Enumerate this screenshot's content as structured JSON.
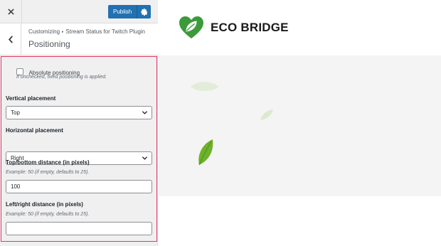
{
  "topbar": {
    "close_icon": "close-icon",
    "publish_label": "Publish",
    "settings_icon": "gear-icon"
  },
  "section": {
    "back_icon": "chevron-left-icon",
    "breadcrumb_root": "Customizing",
    "breadcrumb_separator": "▸",
    "breadcrumb_item": "Stream Status for Twitch Plugin",
    "title": "Positioning"
  },
  "controls": {
    "absolute": {
      "label": "Absolute positioning",
      "checked": false,
      "hint": "If unchecked, fixed positioning is applied."
    },
    "vertical": {
      "label": "Vertical placement",
      "value": "Top"
    },
    "horizontal": {
      "label": "Horizontal placement",
      "value": "Right"
    },
    "top_bottom": {
      "label": "Top/bottom distance (in pixels)",
      "hint": "Example: 50 (if empty, defaults to 25).",
      "value": "100"
    },
    "left_right": {
      "label": "Left/right distance (in pixels)",
      "hint": "Example: 50 (if empty, defaults to 25).",
      "value": ""
    }
  },
  "preview": {
    "brand_name": "ECO BRIDGE",
    "logo_icon": "leaf-heart-logo",
    "accent_color": "#3c9a3a"
  },
  "colors": {
    "primary_button": "#2271b1",
    "highlight_border": "#e03a64",
    "sidebar_bg": "#f0f0f1"
  }
}
